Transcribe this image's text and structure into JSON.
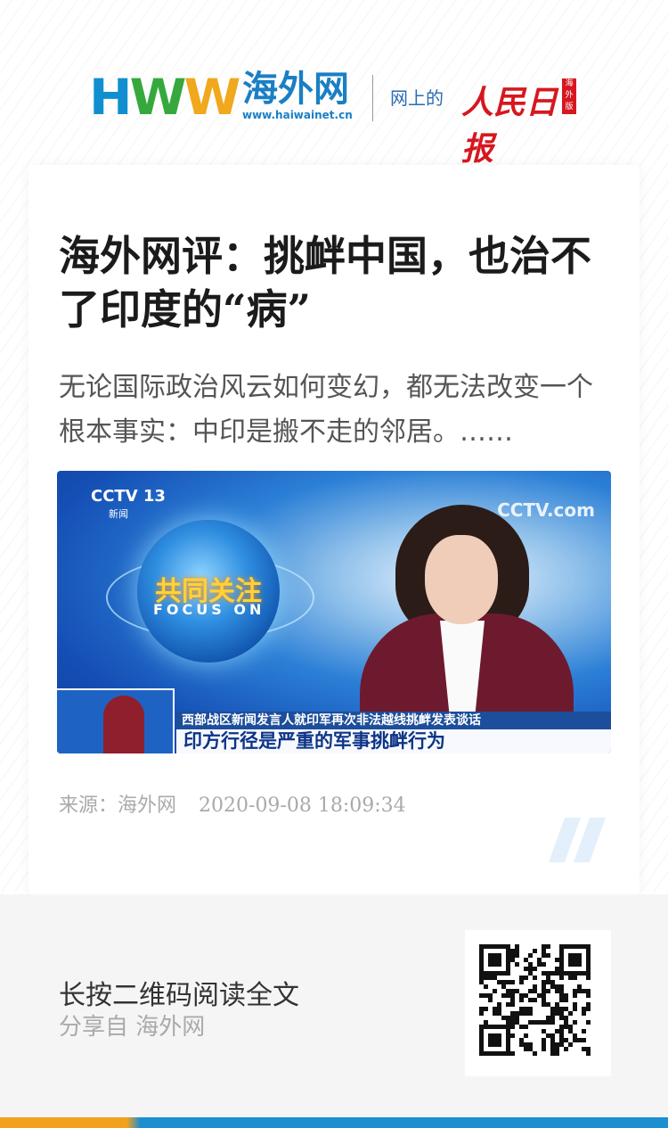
{
  "header": {
    "logo_letters": [
      "H",
      "W",
      "W"
    ],
    "site_name": "海外网",
    "site_url": "www.haiwainet.cn",
    "online_label": "网上的",
    "partner_name": "人民日报",
    "edition_label": "海外版"
  },
  "article": {
    "title": "海外网评：挑衅中国，也治不了印度的“病”",
    "summary": "无论国际政治风云如何变幻，都无法改变一个根本事实：中印是搬不走的邻居。……",
    "image": {
      "channel_logo": "CCTV 13",
      "channel_sub": "新闻",
      "watermark": "CCTV.com",
      "segment_cn": "共同关注",
      "segment_en": "FOCUS ON",
      "caption_top": "西部战区新闻发言人就印军再次非法越线挑衅发表谈话",
      "caption_main": "印方行径是严重的军事挑衅行为"
    },
    "source": "来源：海外网",
    "timestamp": "2020-09-08 18:09:34"
  },
  "footer": {
    "cta": "长按二维码阅读全文",
    "share": "分享自 海外网",
    "qr_icon": "qr-code-icon"
  },
  "colors": {
    "brand_blue": "#1a7fc4",
    "brand_green": "#35a93d",
    "brand_orange": "#f0a81c",
    "rmrb_red": "#d7171f",
    "bar_orange": "#f2a11f",
    "bar_blue": "#1b8fd0"
  }
}
